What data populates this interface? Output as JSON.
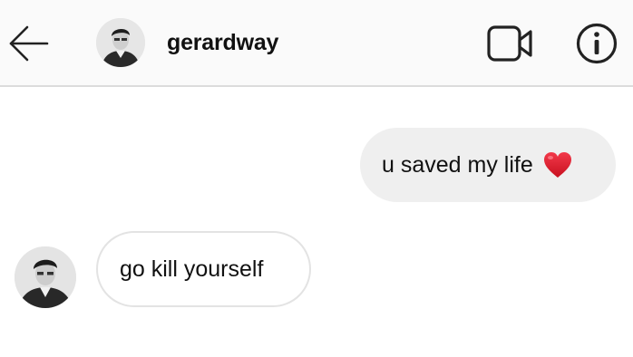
{
  "header": {
    "username": "gerardway",
    "back_icon": "arrow-left-icon",
    "video_icon": "video-camera-icon",
    "info_icon": "info-icon"
  },
  "messages": [
    {
      "direction": "outgoing",
      "text": "u saved my life",
      "emoji": "red-heart-icon"
    },
    {
      "direction": "incoming",
      "text": "go kill yourself"
    }
  ],
  "colors": {
    "header_bg": "#fafafa",
    "outgoing_bubble": "#efefef",
    "incoming_border": "#e3e3e3",
    "heart": "#e0202e"
  }
}
